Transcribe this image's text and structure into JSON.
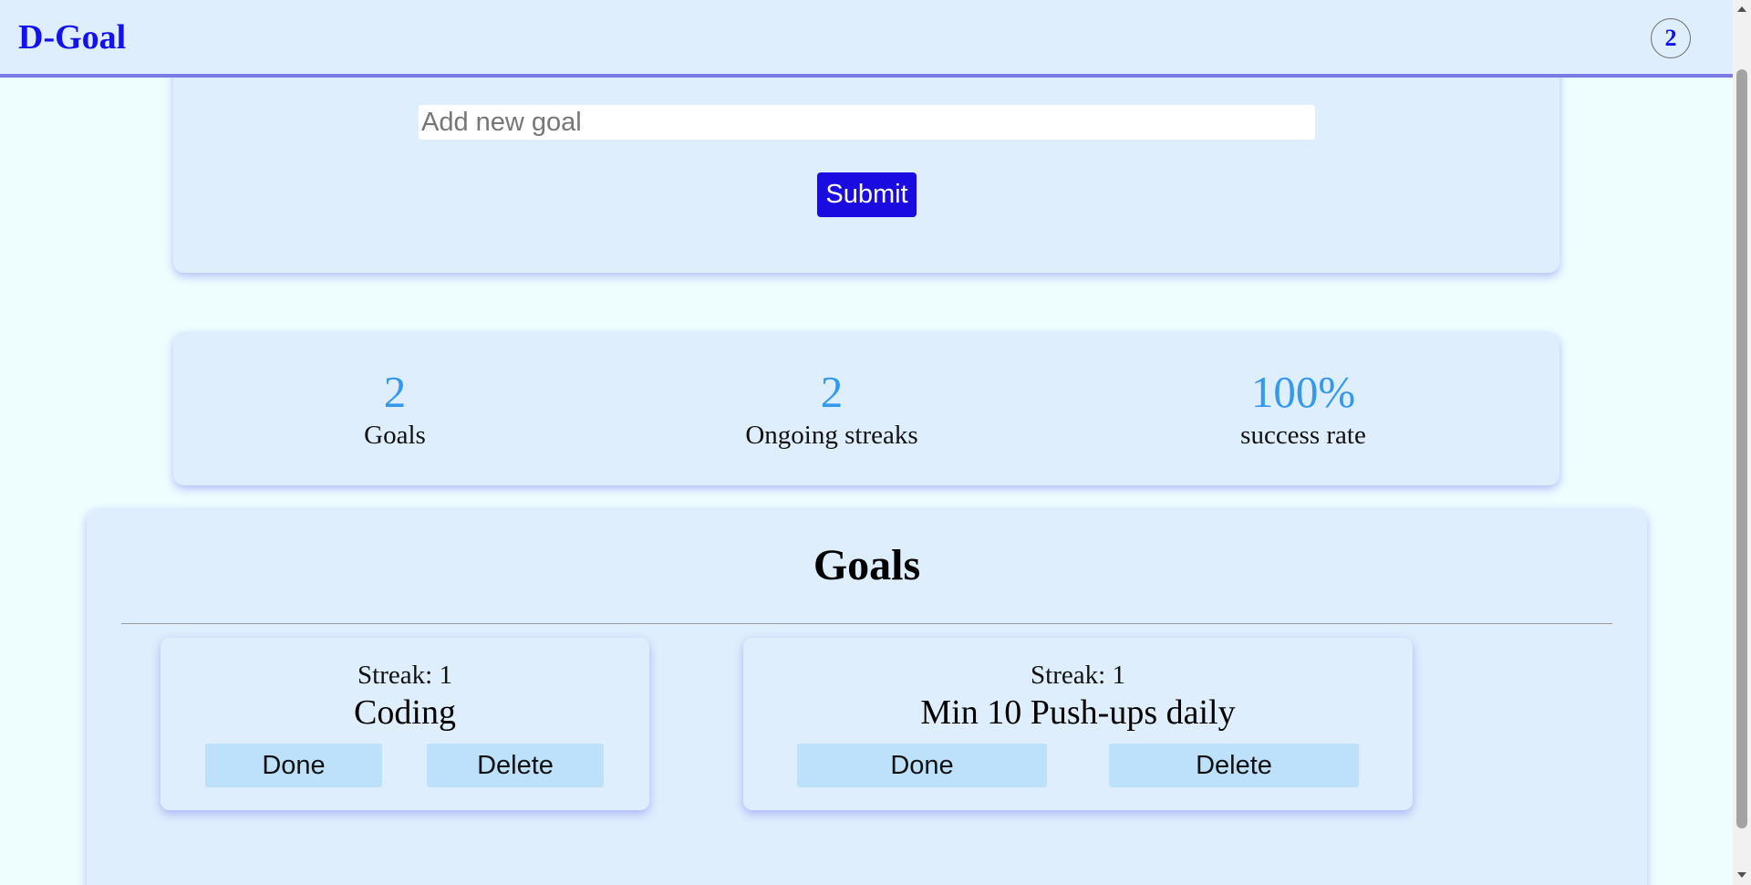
{
  "header": {
    "title": "D-Goal",
    "badge": "2"
  },
  "form": {
    "input_placeholder": "Add new goal",
    "input_value": "",
    "submit_label": "Submit"
  },
  "stats": [
    {
      "value": "2",
      "label": "Goals"
    },
    {
      "value": "2",
      "label": "Ongoing streaks"
    },
    {
      "value": "100%",
      "label": "success rate"
    }
  ],
  "goals": {
    "heading": "Goals",
    "items": [
      {
        "streak": "Streak: 1",
        "name": "Coding",
        "done_label": "Done",
        "delete_label": "Delete"
      },
      {
        "streak": "Streak: 1",
        "name": "Min 10 Push-ups daily",
        "done_label": "Done",
        "delete_label": "Delete"
      }
    ]
  },
  "colors": {
    "brand": "#1212ee",
    "header_bg": "#deeefc",
    "header_border": "#7b7be8",
    "page_bg": "#eefeff",
    "submit_bg": "#1a0be0",
    "stat_value": "#3399f0",
    "goal_button_bg": "#bde0fb"
  }
}
